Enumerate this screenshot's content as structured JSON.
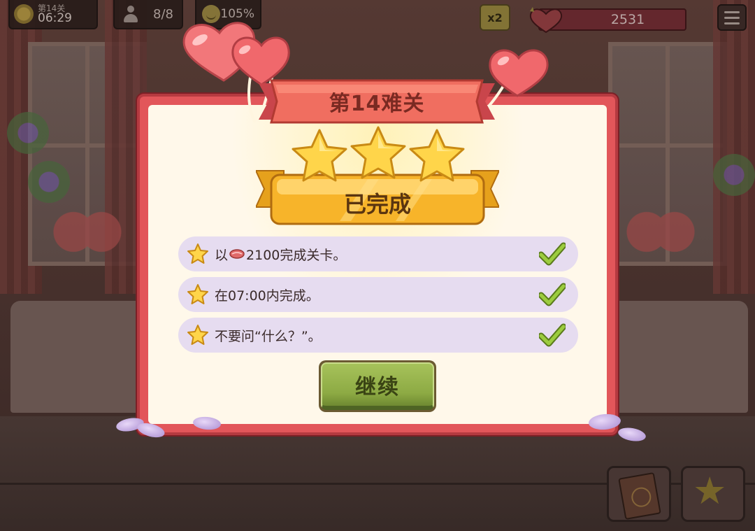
{
  "hud": {
    "level_label": "第14关",
    "clock": "06:29",
    "guests": "8/8",
    "mood": "105%",
    "multiplier": "x2",
    "score": "2531"
  },
  "dialog": {
    "title": "第14难关",
    "stars_earned": 3,
    "status": "已完成",
    "objectives": [
      {
        "prefix": "以",
        "icon": "steak-icon",
        "text": "2100完成关卡。",
        "completed": true
      },
      {
        "prefix": "",
        "icon": "",
        "text": "在07:00内完成。",
        "completed": true
      },
      {
        "prefix": "",
        "icon": "",
        "text": "不要问“什么？”。",
        "completed": true
      }
    ],
    "continue_label": "继续"
  },
  "colors": {
    "frame_red": "#e2565a",
    "panel_cream": "#fff8ea",
    "objective_bg": "#e6dcf0",
    "star_gold": "#ffd54a",
    "check_green": "#8cc43a",
    "button_green": "#9ab84e"
  }
}
